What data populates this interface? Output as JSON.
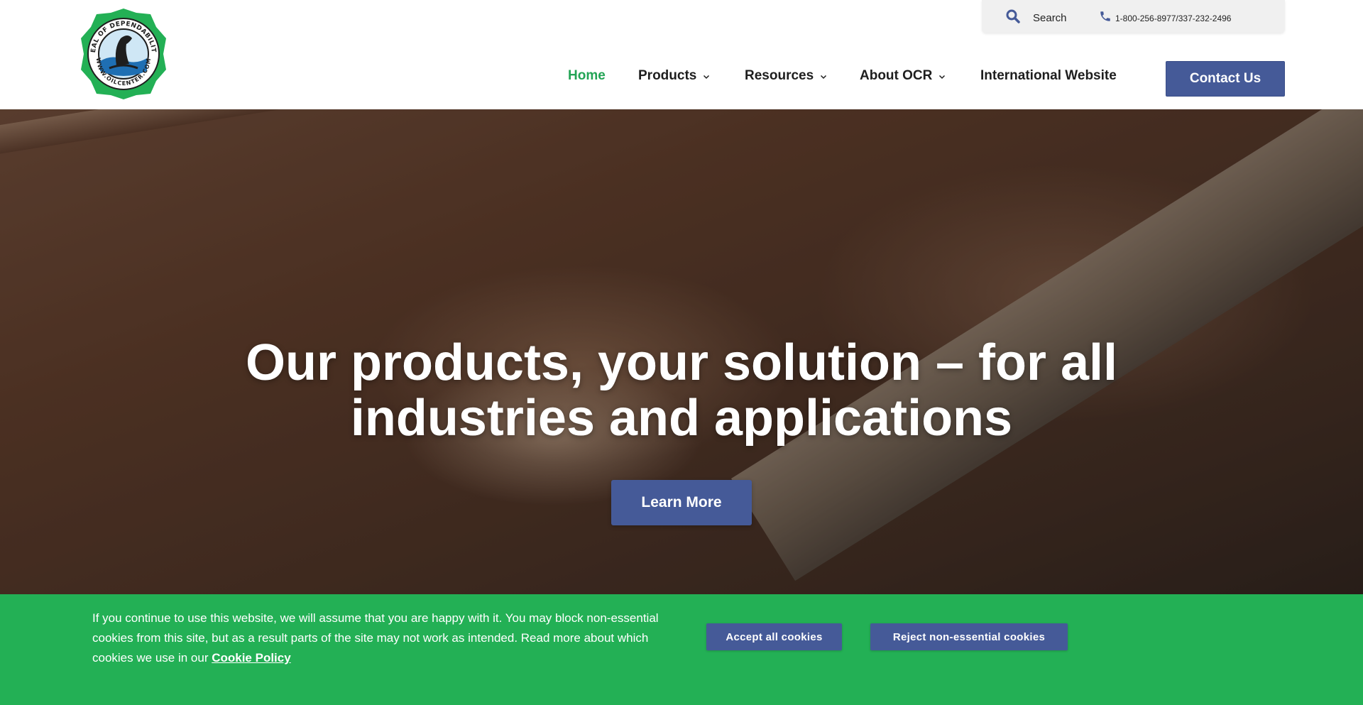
{
  "header": {
    "utility": {
      "search_label": "Search",
      "phone": "1-800-256-8977/337-232-2496"
    },
    "nav": [
      {
        "label": "Home",
        "active": true,
        "dropdown": false
      },
      {
        "label": "Products",
        "active": false,
        "dropdown": true
      },
      {
        "label": "Resources",
        "active": false,
        "dropdown": true
      },
      {
        "label": "About OCR",
        "active": false,
        "dropdown": true
      },
      {
        "label": "International Website",
        "active": false,
        "dropdown": false
      }
    ],
    "contact_label": "Contact Us",
    "logo": {
      "text_top": "SEAL OF DEPENDABILITY",
      "text_bottom": "WWW.OILCENTER.COM"
    }
  },
  "hero": {
    "title_line1": "Our products, your solution – for all",
    "title_line2": "industries and applications",
    "cta_label": "Learn More"
  },
  "cookie": {
    "text": "If you continue to use this website, we will assume that you are happy with it. You may block non-essential cookies from this site, but as a result parts of the site may not work as intended. Read more about which cookies we use in our ",
    "link_label": "Cookie Policy",
    "accept_label": "Accept all cookies",
    "reject_label": "Reject non-essential cookies"
  },
  "colors": {
    "brand_green": "#23b055",
    "nav_active": "#23a455",
    "button_blue": "#455a98"
  },
  "icons": [
    "logo-seal",
    "search-icon",
    "phone-icon",
    "chevron-down-icon"
  ]
}
